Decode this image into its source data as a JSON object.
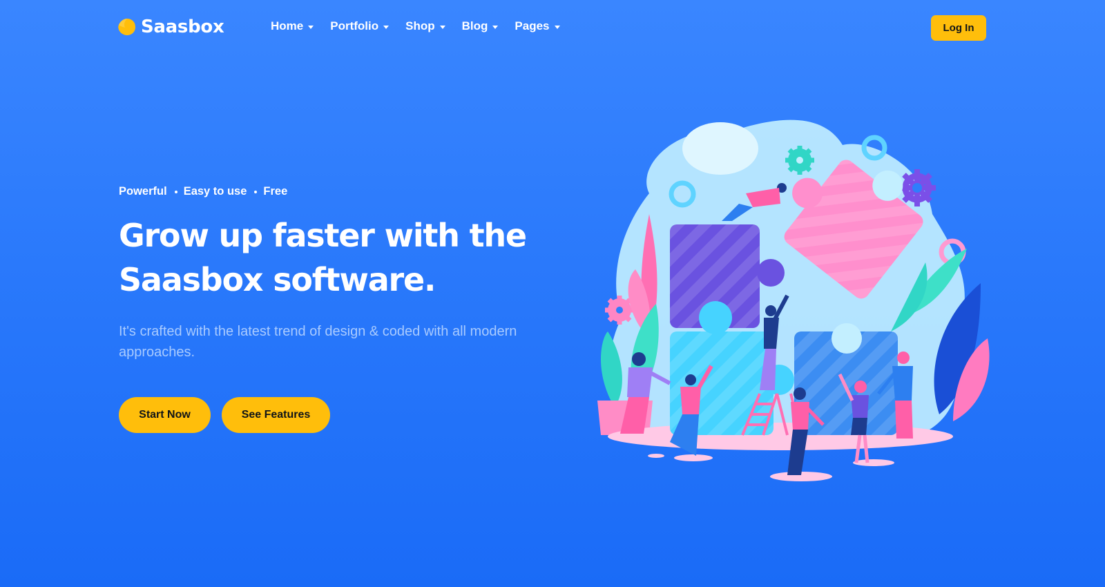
{
  "brand": {
    "name": "Saasbox",
    "logo_color": "#ffbe0b"
  },
  "nav": {
    "items": [
      {
        "label": "Home"
      },
      {
        "label": "Portfolio"
      },
      {
        "label": "Shop"
      },
      {
        "label": "Blog"
      },
      {
        "label": "Pages"
      }
    ],
    "login_label": "Log In"
  },
  "hero": {
    "tags": [
      "Powerful",
      "Easy to use",
      "Free"
    ],
    "headline_line1": "Grow up faster with the",
    "headline_line2": "Saasbox software.",
    "subtext": "It's crafted with the latest trend of design & coded with all modern approaches.",
    "primary_cta": "Start Now",
    "secondary_cta": "See Features"
  },
  "colors": {
    "background_top": "#3a86ff",
    "background_bottom": "#1a6bf7",
    "accent": "#ffbe0b",
    "button_text": "#101418"
  },
  "illustration": {
    "icon": "team-assembling-puzzle-illustration"
  }
}
